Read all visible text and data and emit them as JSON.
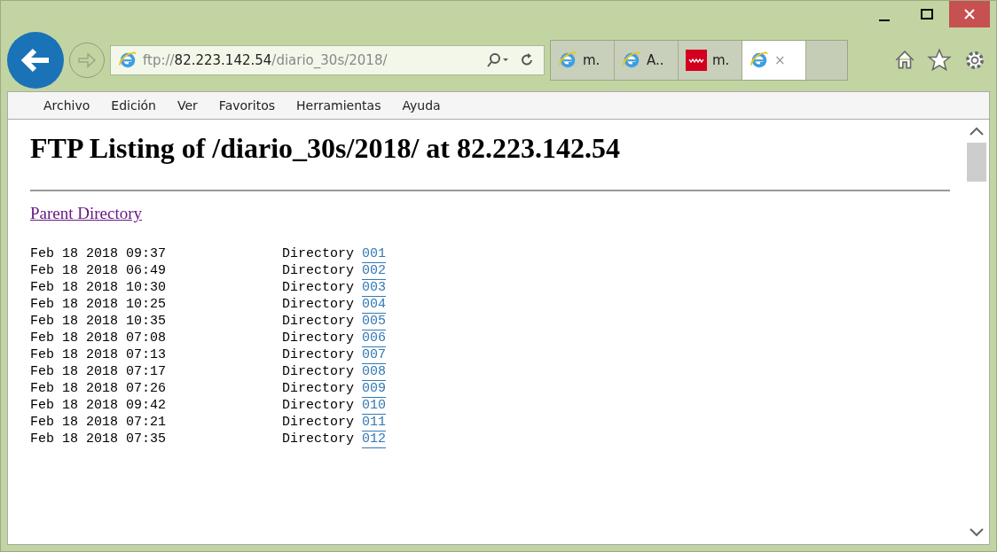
{
  "address_bar": {
    "scheme": "ftp://",
    "host": "82.223.142.54",
    "path": "/diario_30s/2018/"
  },
  "tabs": [
    {
      "label": "m.",
      "kind": "browser",
      "selected": false
    },
    {
      "label": "A..",
      "kind": "browser",
      "selected": false
    },
    {
      "label": "m.",
      "kind": "site",
      "selected": false
    },
    {
      "label": "×",
      "kind": "browser",
      "selected": true
    }
  ],
  "menu": [
    "Archivo",
    "Edición",
    "Ver",
    "Favoritos",
    "Herramientas",
    "Ayuda"
  ],
  "page": {
    "title": "FTP Listing of /diario_30s/2018/ at 82.223.142.54",
    "parent_link": "Parent Directory",
    "rows": [
      {
        "date": "Feb 18 2018 09:37",
        "type": "Directory",
        "name": "001"
      },
      {
        "date": "Feb 18 2018 06:49",
        "type": "Directory",
        "name": "002"
      },
      {
        "date": "Feb 18 2018 10:30",
        "type": "Directory",
        "name": "003"
      },
      {
        "date": "Feb 18 2018 10:25",
        "type": "Directory",
        "name": "004"
      },
      {
        "date": "Feb 18 2018 10:35",
        "type": "Directory",
        "name": "005"
      },
      {
        "date": "Feb 18 2018 07:08",
        "type": "Directory",
        "name": "006"
      },
      {
        "date": "Feb 18 2018 07:13",
        "type": "Directory",
        "name": "007"
      },
      {
        "date": "Feb 18 2018 07:17",
        "type": "Directory",
        "name": "008"
      },
      {
        "date": "Feb 18 2018 07:26",
        "type": "Directory",
        "name": "009"
      },
      {
        "date": "Feb 18 2018 09:42",
        "type": "Directory",
        "name": "010"
      },
      {
        "date": "Feb 18 2018 07:21",
        "type": "Directory",
        "name": "011"
      },
      {
        "date": "Feb 18 2018 07:35",
        "type": "Directory",
        "name": "012"
      }
    ]
  }
}
